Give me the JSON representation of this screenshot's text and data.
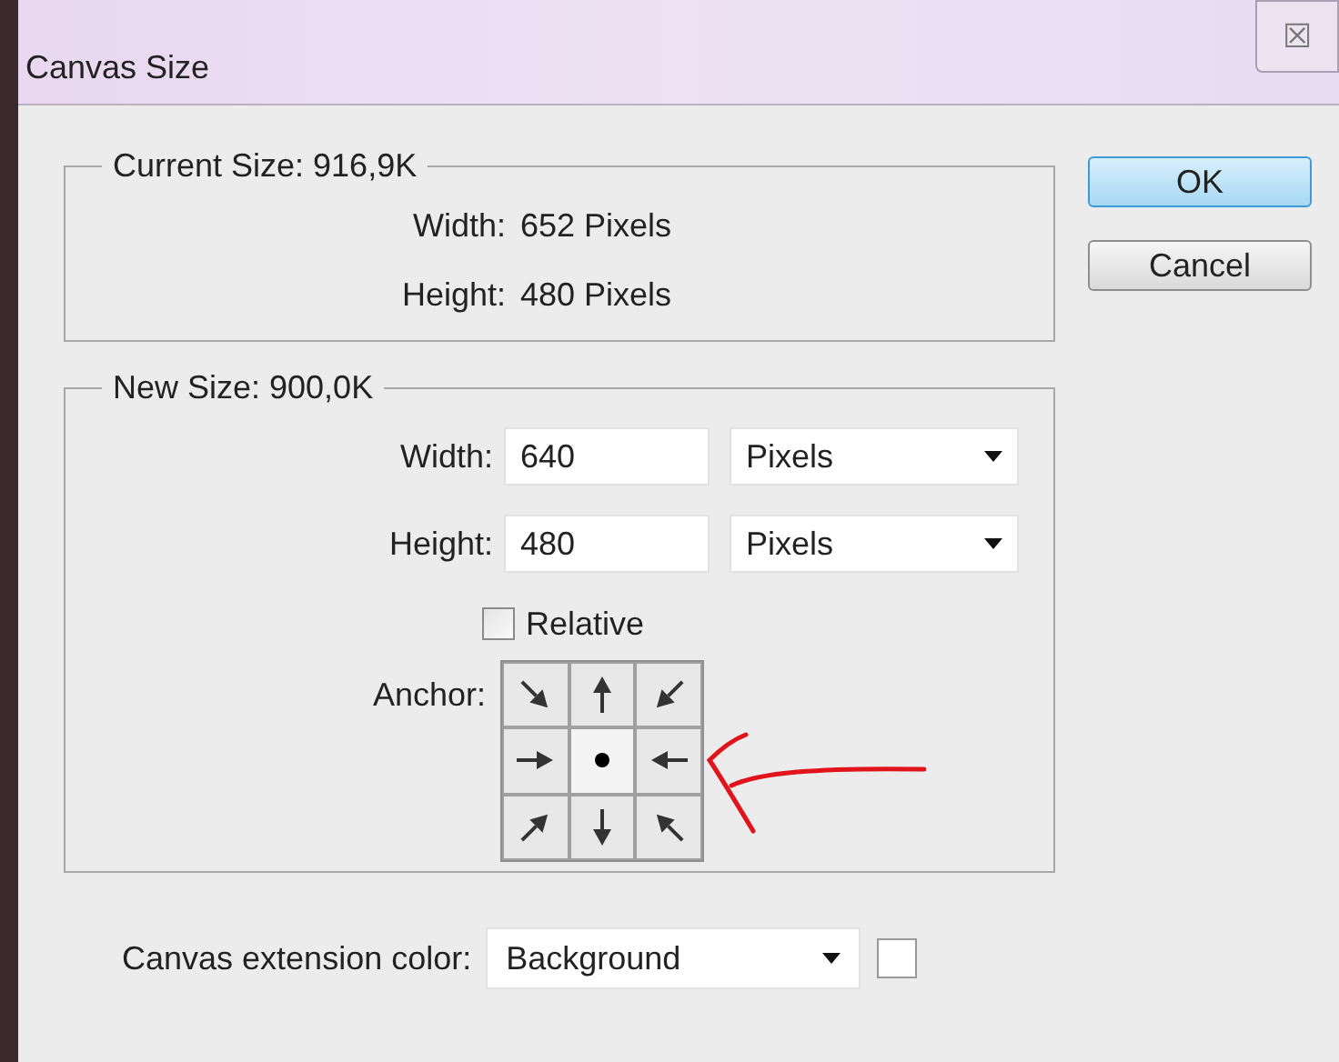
{
  "window": {
    "title": "Canvas Size",
    "close": "☒"
  },
  "current_size": {
    "legend": "Current Size: 916,9K",
    "rows": [
      {
        "label": "Width:",
        "value": "652 Pixels"
      },
      {
        "label": "Height:",
        "value": "480 Pixels"
      }
    ]
  },
  "new_size": {
    "legend": "New Size: 900,0K",
    "fields": [
      {
        "label": "Width:",
        "value": "640",
        "unit": "Pixels"
      },
      {
        "label": "Height:",
        "value": "480",
        "unit": "Pixels"
      }
    ],
    "relative": {
      "label": "Relative",
      "checked": false
    },
    "anchor": {
      "label": "Anchor:",
      "cells": [
        {
          "selected": false
        },
        {
          "selected": false
        },
        {
          "selected": false
        },
        {
          "selected": false
        },
        {
          "selected": true
        },
        {
          "selected": false
        },
        {
          "selected": false
        },
        {
          "selected": false
        },
        {
          "selected": false
        }
      ]
    }
  },
  "extension": {
    "label": "Canvas extension color:",
    "value": "Background"
  },
  "buttons": [
    {
      "label": "OK",
      "default": true
    },
    {
      "label": "Cancel",
      "default": false
    }
  ]
}
